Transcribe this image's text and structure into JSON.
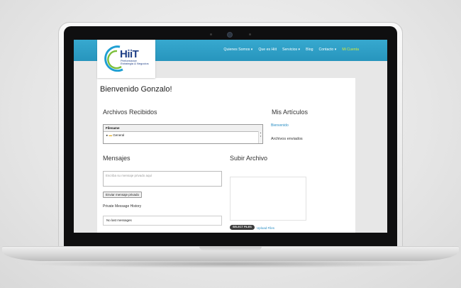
{
  "logo": {
    "text": "HiiT",
    "subtitle": "Performance\nEstrategia & Negocios"
  },
  "nav": {
    "items": [
      {
        "label": "Quienes Somos ▾"
      },
      {
        "label": "Que es Hiit"
      },
      {
        "label": "Servicios ▾"
      },
      {
        "label": "Blog"
      },
      {
        "label": "Contacto ▾"
      },
      {
        "label": "Mi Cuenta"
      }
    ]
  },
  "welcome": {
    "prefix": "Bienvenido ",
    "name": "Gonzalo!"
  },
  "archivos": {
    "title": "Archivos Recibidos",
    "column_header": "Filename",
    "folder": "General"
  },
  "articulos": {
    "title": "Mis Artículos",
    "link": "Bienvenido",
    "sent": "Archivos enviados"
  },
  "mensajes": {
    "title": "Mensajes",
    "placeholder": "Escriba su mensaje privado aquí",
    "send_button": "Enviar mensaje privado",
    "history_label": "Private Message History",
    "history_empty": "No last messages"
  },
  "subir": {
    "title": "Subir Archivo",
    "select_button": "SELECT FILES",
    "upload_link": "Upload Files"
  },
  "colors": {
    "nav_bg": "#2d9cc6",
    "active_nav": "#d7e83a",
    "link": "#2a8ec4"
  }
}
